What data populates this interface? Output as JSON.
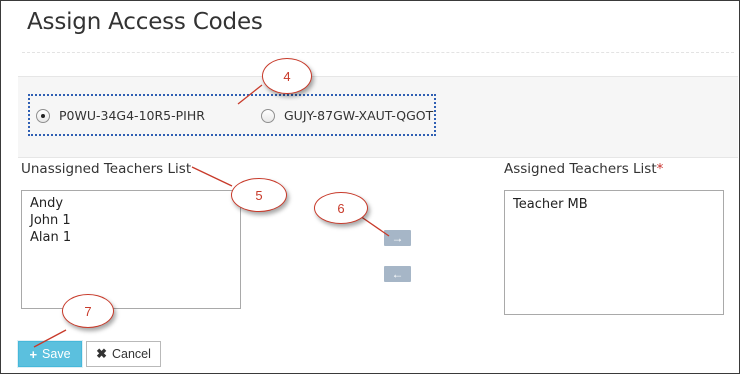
{
  "page": {
    "title": "Assign Access Codes"
  },
  "access_codes": {
    "options": [
      {
        "label": "P0WU-34G4-10R5-PIHR",
        "selected": true
      },
      {
        "label": "GUJY-87GW-XAUT-QGOT",
        "selected": false
      }
    ]
  },
  "unassigned": {
    "label": "Unassigned Teachers List",
    "items": [
      "Andy",
      "John 1",
      "Alan 1"
    ]
  },
  "assigned": {
    "label": "Assigned Teachers List",
    "required_mark": "*",
    "items": [
      "Teacher MB"
    ]
  },
  "move_buttons": {
    "assign_icon": "arrow-right-icon",
    "unassign_icon": "arrow-left-icon"
  },
  "actions": {
    "save_label": "Save",
    "save_icon": "plus-icon",
    "cancel_label": "Cancel",
    "cancel_icon": "times-icon"
  },
  "annotations": [
    "4",
    "5",
    "6",
    "7"
  ],
  "colors": {
    "annotation": "#c83a2a",
    "save_button": "#5bc0de",
    "selection_outline": "#2f5fb3",
    "move_button": "#a6b6c7"
  }
}
